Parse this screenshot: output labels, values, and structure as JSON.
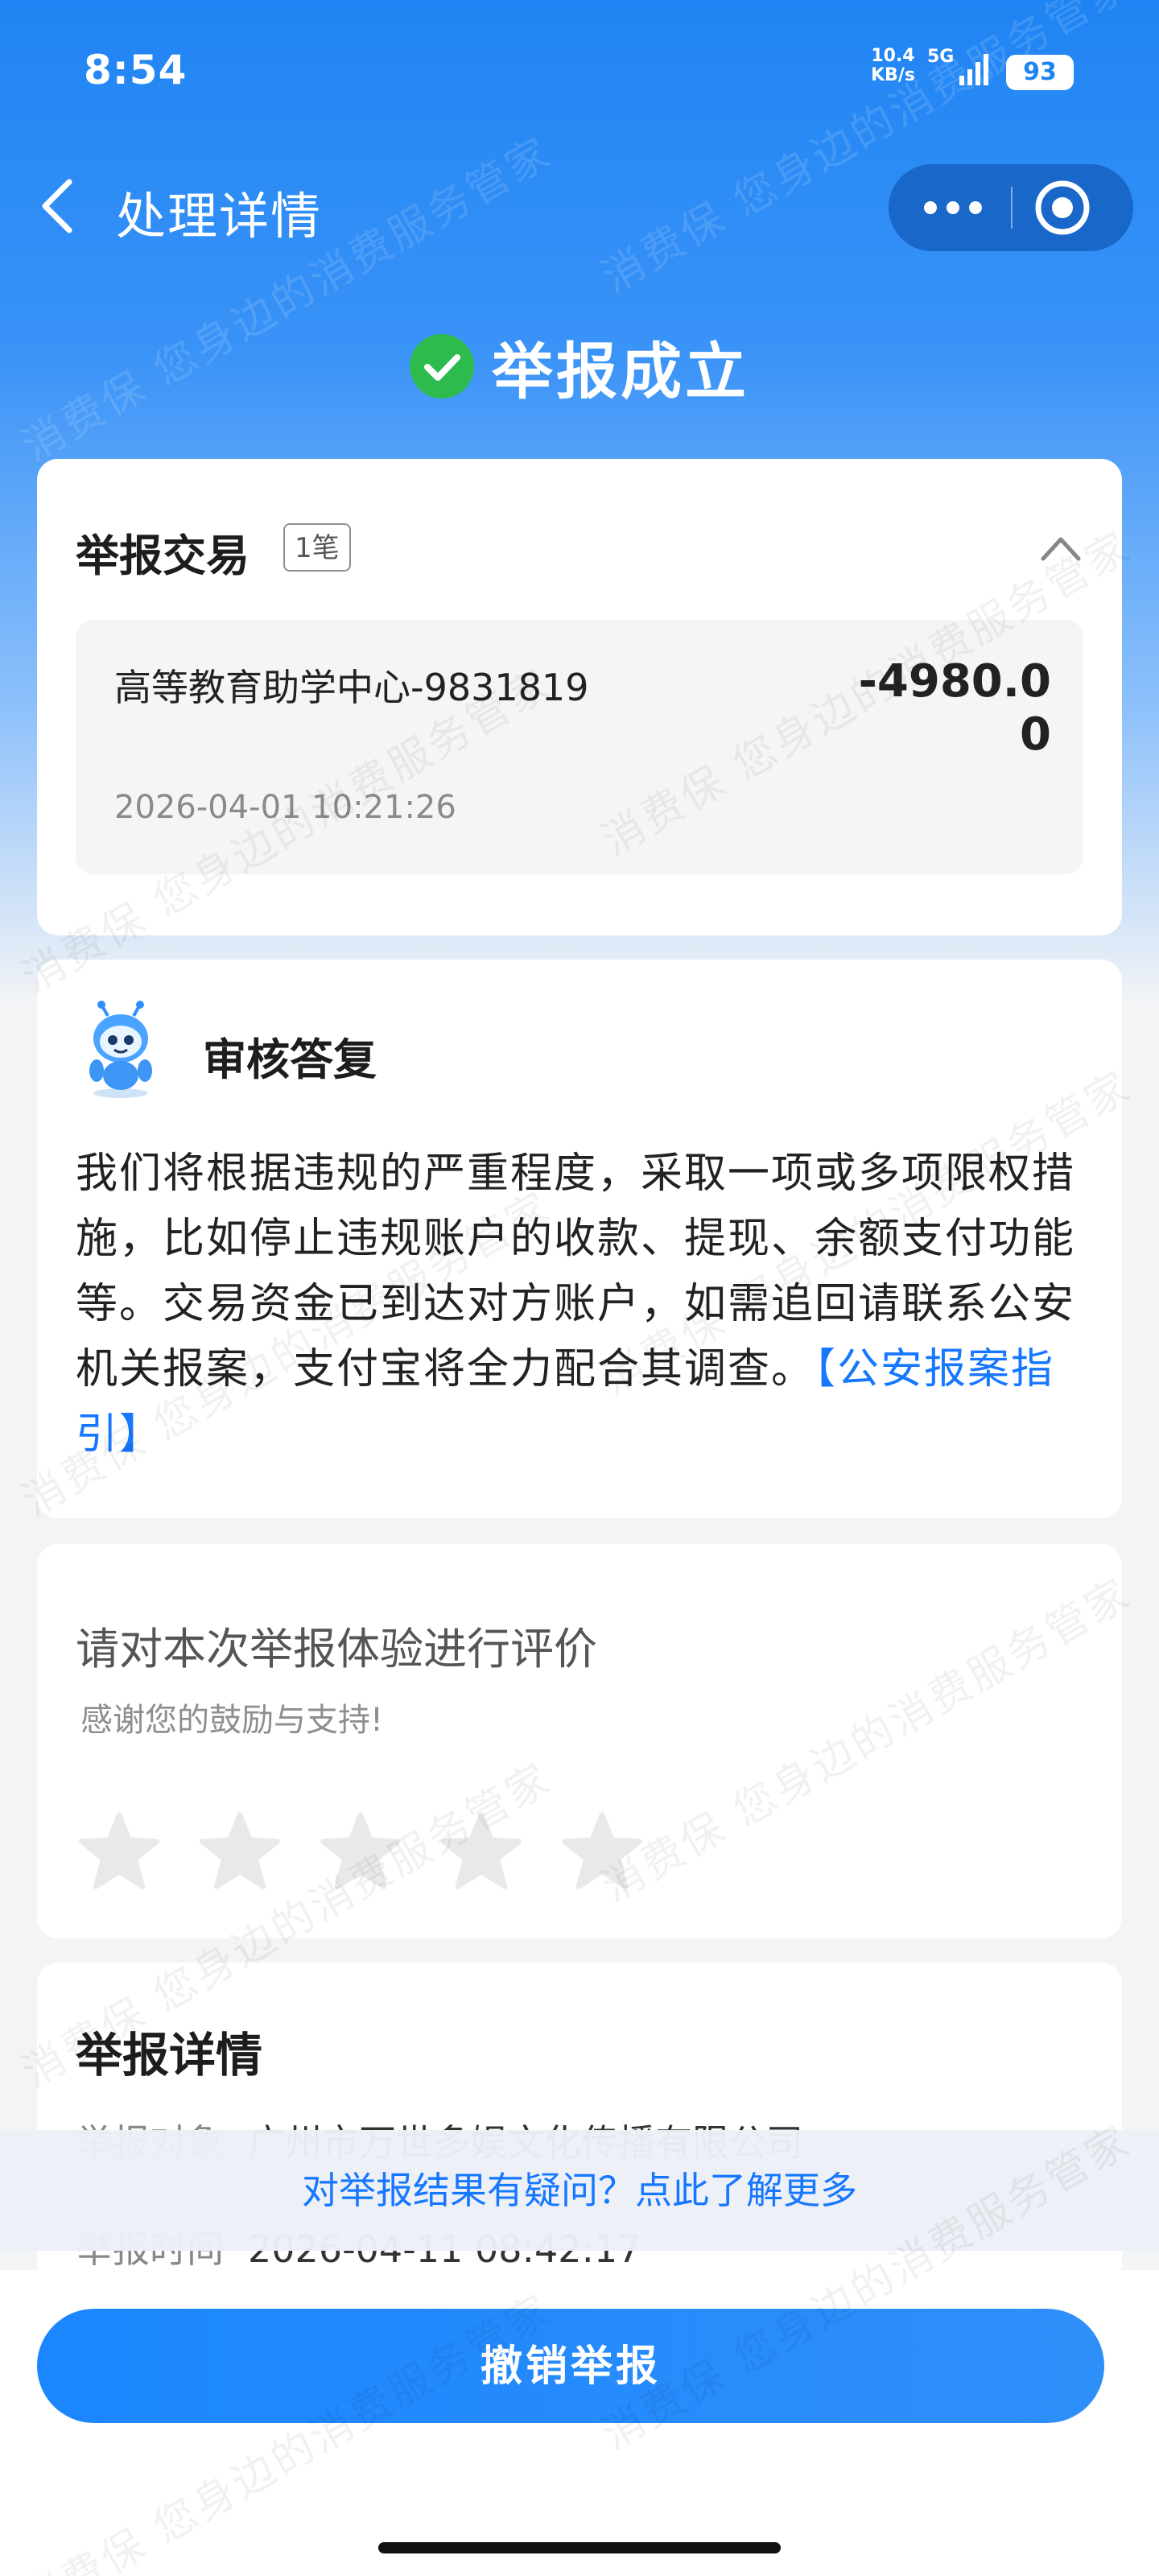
{
  "status_bar": {
    "time": "8:54",
    "network_speed_value": "10.4",
    "network_speed_unit": "KB/s",
    "network_type": "5G",
    "battery": "93"
  },
  "nav": {
    "title": "处理详情"
  },
  "result": {
    "status_text": "举报成立"
  },
  "transaction": {
    "title": "举报交易",
    "count_badge": "1笔",
    "merchant": "高等教育助学中心-9831819",
    "amount": "-4980.00",
    "datetime": "2026-04-01 10:21:26"
  },
  "reply": {
    "title": "审核答复",
    "body": "我们将根据违规的严重程度，采取一项或多项限权措施，比如停止违规账户的收款、提现、余额支付功能等。交易资金已到达对方账户，如需追回请联系公安机关报案，支付宝将全力配合其调查。",
    "link_text": "【公安报案指引】"
  },
  "rating": {
    "title": "请对本次举报体验进行评价",
    "subtitle": "感谢您的鼓励与支持!",
    "max_stars": 5,
    "selected_stars": 0
  },
  "details": {
    "title": "举报详情",
    "rows": [
      {
        "label": "举报对象",
        "value": "广州市万世多娱文化传播有限公司"
      },
      {
        "label": "举报时间",
        "value": "2026-04-11 08:42:17"
      }
    ]
  },
  "question_bar": {
    "text": "对举报结果有疑问？点此了解更多"
  },
  "bottom": {
    "cancel_button": "撤销举报"
  },
  "watermark": {
    "text": "消费保 您身边的消费服务管家"
  },
  "colors": {
    "primary_blue": "#1677ff",
    "header_blue": "#1f84f3",
    "success_green": "#2dbb4e"
  }
}
